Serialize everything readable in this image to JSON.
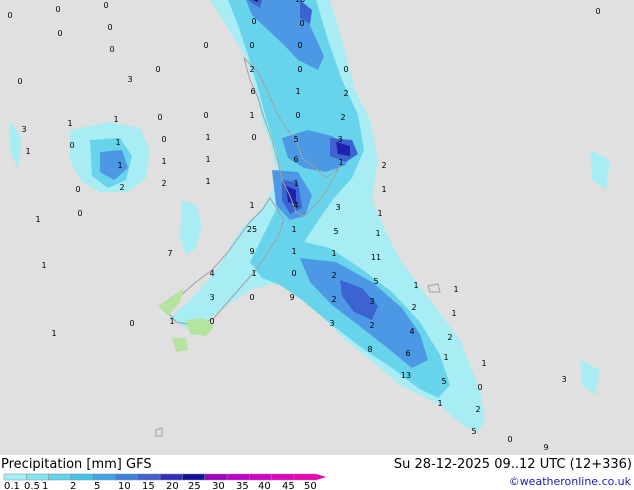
{
  "header": {
    "title": "Precipitation [mm]",
    "model": "GFS",
    "datetime": "Su 28-12-2025 09..12 UTC (12+336)",
    "credit": "©weatheronline.co.uk"
  },
  "legend": {
    "labels": [
      "0.1",
      "0.5",
      "1",
      "2",
      "5",
      "10",
      "15",
      "20",
      "25",
      "30",
      "35",
      "40",
      "45",
      "50"
    ],
    "colors": [
      "#a0f0f8",
      "#80e4f0",
      "#60d4ec",
      "#40c4e8",
      "#40a4e4",
      "#4080dc",
      "#4060d4",
      "#3030c0",
      "#1010a0",
      "#a000c8",
      "#c000d0",
      "#d000c8",
      "#e000c0",
      "#f000b8"
    ]
  },
  "colors": {
    "sea": "#e0e0e0",
    "land": "#b4e4a0",
    "coast": "#a0a0a0",
    "light_rain": "#a8ecf4",
    "moderate_rain": "#68d4ec",
    "heavy_rain": "#4c98e4",
    "very_heavy_rain": "#3c64d0",
    "extreme_rain": "#2020b0"
  },
  "map_values": [
    "0",
    "0",
    "0",
    "0",
    "0",
    "0",
    "0",
    "0",
    "1",
    "1",
    "0",
    "0",
    "0",
    "0",
    "1",
    "1",
    "1",
    "1",
    "1",
    "2",
    "2",
    "1",
    "1",
    "0",
    "0",
    "6",
    "1",
    "2",
    "0",
    "0",
    "0",
    "0",
    "1",
    "0",
    "0",
    "1",
    "1",
    "1",
    "0",
    "0",
    "0",
    "0",
    "4",
    "16",
    "0",
    "2",
    "2",
    "5",
    "3",
    "6",
    "1",
    "1",
    "2",
    "1",
    "1",
    "1",
    "4",
    "3",
    "25",
    "1",
    "5",
    "1",
    "9",
    "1",
    "1",
    "11",
    "4",
    "1",
    "0",
    "2",
    "5",
    "1",
    "1",
    "3",
    "0",
    "9",
    "2",
    "3",
    "2",
    "1",
    "3",
    "2",
    "4",
    "2",
    "8",
    "6",
    "1",
    "1",
    "13",
    "5",
    "0",
    "1",
    "2",
    "5",
    "0",
    "9",
    "3",
    "1",
    "0",
    "7",
    "3",
    "3",
    "3",
    "3",
    "1",
    "0",
    "1",
    "0",
    "0",
    "0",
    "0",
    "0"
  ]
}
